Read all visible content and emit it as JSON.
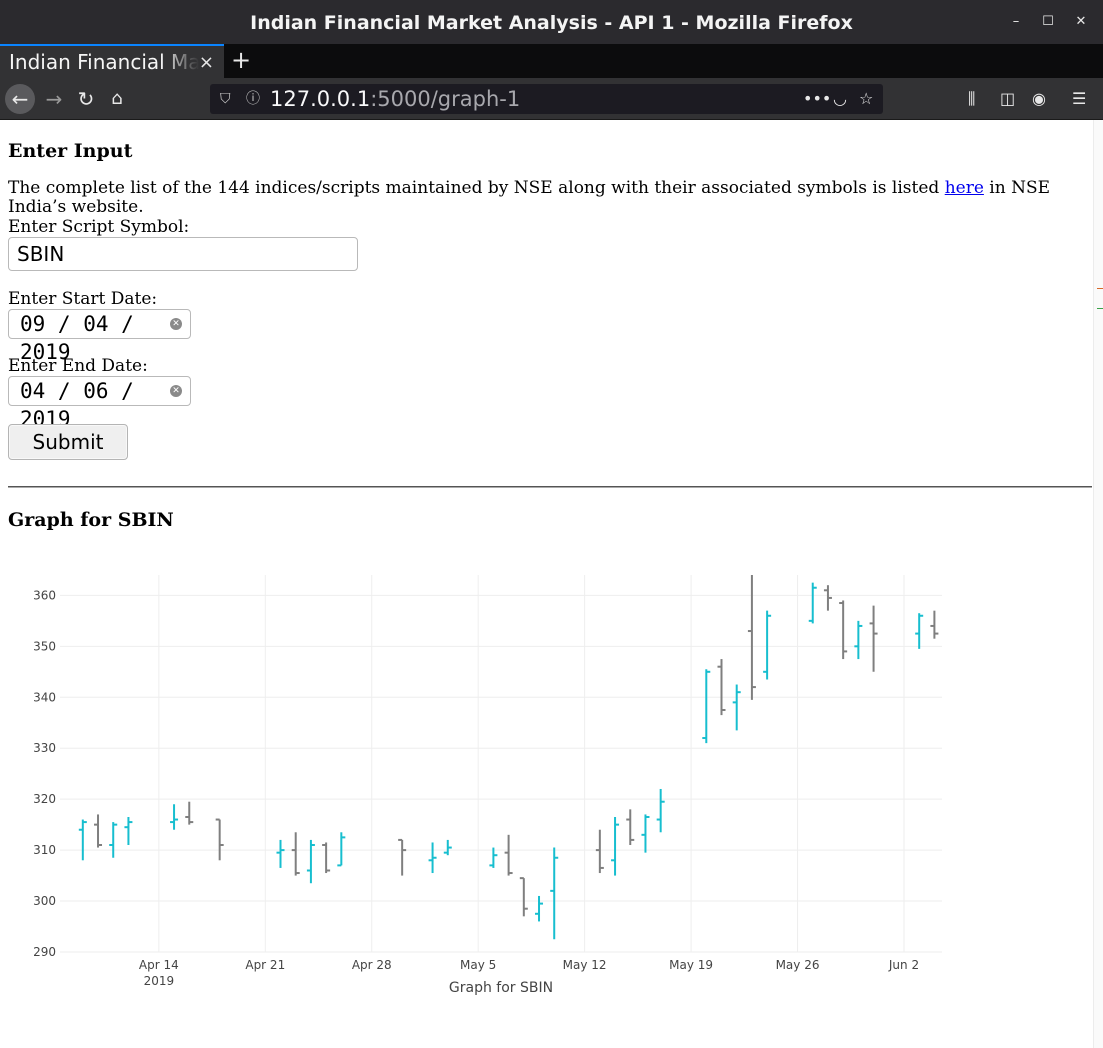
{
  "window": {
    "title": "Indian Financial Market Analysis - API 1 - Mozilla Firefox",
    "minimize": "–",
    "maximize": "☐",
    "close": "✕"
  },
  "tab": {
    "label": "Indian Financial Market Analysis - API 1",
    "close": "×",
    "new": "+"
  },
  "url": {
    "host": "127.0.0.1",
    "rest": ":5000/graph-1"
  },
  "page": {
    "heading": "Enter Input",
    "intro_before": "The complete list of the 144 indices/scripts maintained by NSE along with their associated symbols is listed ",
    "intro_link": "here",
    "intro_after": " in NSE India’s website.",
    "symbol_label": "Enter Script Symbol:",
    "symbol_value": "SBIN",
    "start_label": "Enter Start Date:",
    "start_value": "09 / 04 / 2019",
    "end_label": "Enter End Date:",
    "end_value": "04 / 06 / 2019",
    "submit": "Submit",
    "graph_heading": "Graph for SBIN"
  },
  "colors": {
    "increasing": "#17becf",
    "decreasing": "#7f7f7f",
    "grid": "#eeeeee",
    "link": "#0000ee"
  },
  "chart_data": {
    "type": "ohlc",
    "xlabel": "Graph for SBIN",
    "ylim": [
      290,
      364
    ],
    "yticks": [
      290,
      300,
      310,
      320,
      330,
      340,
      350,
      360
    ],
    "xticks": [
      {
        "date": "2019-04-14",
        "label": "Apr 14",
        "sub": "2019"
      },
      {
        "date": "2019-04-21",
        "label": "Apr 21",
        "sub": ""
      },
      {
        "date": "2019-04-28",
        "label": "Apr 28",
        "sub": ""
      },
      {
        "date": "2019-05-05",
        "label": "May 5",
        "sub": ""
      },
      {
        "date": "2019-05-12",
        "label": "May 12",
        "sub": ""
      },
      {
        "date": "2019-05-19",
        "label": "May 19",
        "sub": ""
      },
      {
        "date": "2019-05-26",
        "label": "May 26",
        "sub": ""
      },
      {
        "date": "2019-06-02",
        "label": "Jun 2",
        "sub": ""
      }
    ],
    "x_range": [
      "2019-04-08",
      "2019-06-04"
    ],
    "grid": true,
    "legend": "none",
    "candles": [
      {
        "date": "2019-04-09",
        "open": 314,
        "high": 316,
        "low": 308,
        "close": 315.5
      },
      {
        "date": "2019-04-10",
        "open": 315,
        "high": 317,
        "low": 310.5,
        "close": 311
      },
      {
        "date": "2019-04-11",
        "open": 311,
        "high": 315.5,
        "low": 308.5,
        "close": 315
      },
      {
        "date": "2019-04-12",
        "open": 314.5,
        "high": 316.5,
        "low": 311,
        "close": 315.5
      },
      {
        "date": "2019-04-15",
        "open": 315.5,
        "high": 319,
        "low": 314,
        "close": 316
      },
      {
        "date": "2019-04-16",
        "open": 316.5,
        "high": 319.5,
        "low": 315,
        "close": 315.5
      },
      {
        "date": "2019-04-18",
        "open": 316,
        "high": 316,
        "low": 308,
        "close": 311
      },
      {
        "date": "2019-04-22",
        "open": 309.5,
        "high": 312,
        "low": 306.5,
        "close": 310
      },
      {
        "date": "2019-04-23",
        "open": 310,
        "high": 313.5,
        "low": 305,
        "close": 305.5
      },
      {
        "date": "2019-04-24",
        "open": 306,
        "high": 312,
        "low": 303.5,
        "close": 311
      },
      {
        "date": "2019-04-25",
        "open": 311,
        "high": 311.5,
        "low": 305.5,
        "close": 306
      },
      {
        "date": "2019-04-26",
        "open": 307,
        "high": 313.5,
        "low": 307,
        "close": 312.5
      },
      {
        "date": "2019-04-30",
        "open": 312,
        "high": 312,
        "low": 305,
        "close": 310
      },
      {
        "date": "2019-05-02",
        "open": 308,
        "high": 311.5,
        "low": 305.5,
        "close": 308.5
      },
      {
        "date": "2019-05-03",
        "open": 309.5,
        "high": 312,
        "low": 309,
        "close": 310.5
      },
      {
        "date": "2019-05-06",
        "open": 307,
        "high": 310.5,
        "low": 306.5,
        "close": 309
      },
      {
        "date": "2019-05-07",
        "open": 309.5,
        "high": 313,
        "low": 305,
        "close": 305.5
      },
      {
        "date": "2019-05-08",
        "open": 304.5,
        "high": 304.5,
        "low": 297,
        "close": 298.5
      },
      {
        "date": "2019-05-09",
        "open": 297.5,
        "high": 301,
        "low": 296,
        "close": 299.5
      },
      {
        "date": "2019-05-10",
        "open": 302,
        "high": 310.5,
        "low": 292.5,
        "close": 308.5
      },
      {
        "date": "2019-05-13",
        "open": 310,
        "high": 314,
        "low": 305.5,
        "close": 306.5
      },
      {
        "date": "2019-05-14",
        "open": 308,
        "high": 316.5,
        "low": 305,
        "close": 315
      },
      {
        "date": "2019-05-15",
        "open": 316,
        "high": 318,
        "low": 311,
        "close": 312
      },
      {
        "date": "2019-05-16",
        "open": 313,
        "high": 317,
        "low": 309.5,
        "close": 316.5
      },
      {
        "date": "2019-05-17",
        "open": 316,
        "high": 322,
        "low": 313.5,
        "close": 319.5
      },
      {
        "date": "2019-05-20",
        "open": 332,
        "high": 345.5,
        "low": 331,
        "close": 345
      },
      {
        "date": "2019-05-21",
        "open": 346,
        "high": 347.5,
        "low": 336.5,
        "close": 337.5
      },
      {
        "date": "2019-05-22",
        "open": 339,
        "high": 342.5,
        "low": 333.5,
        "close": 341
      },
      {
        "date": "2019-05-23",
        "open": 353,
        "high": 364,
        "low": 339.5,
        "close": 342
      },
      {
        "date": "2019-05-24",
        "open": 345,
        "high": 357,
        "low": 343.5,
        "close": 356
      },
      {
        "date": "2019-05-27",
        "open": 355,
        "high": 362.5,
        "low": 354.5,
        "close": 361.5
      },
      {
        "date": "2019-05-28",
        "open": 361,
        "high": 362,
        "low": 357,
        "close": 359.5
      },
      {
        "date": "2019-05-29",
        "open": 358.5,
        "high": 359,
        "low": 347.5,
        "close": 349
      },
      {
        "date": "2019-05-30",
        "open": 350,
        "high": 355,
        "low": 347.5,
        "close": 354
      },
      {
        "date": "2019-05-31",
        "open": 354.5,
        "high": 358,
        "low": 345,
        "close": 352.5
      },
      {
        "date": "2019-06-03",
        "open": 352.5,
        "high": 356.5,
        "low": 349.5,
        "close": 356
      },
      {
        "date": "2019-06-04",
        "open": 354,
        "high": 357,
        "low": 351.5,
        "close": 352.5
      }
    ]
  }
}
